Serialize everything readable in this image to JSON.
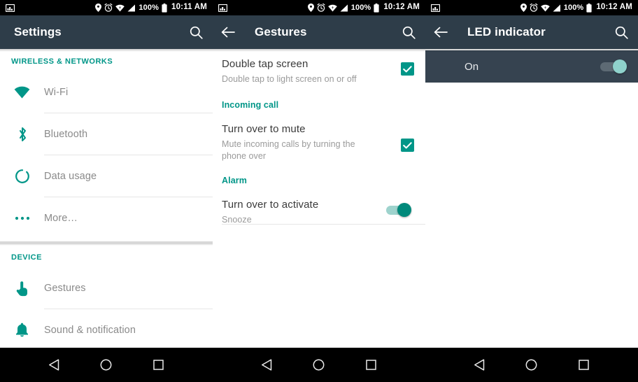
{
  "status_bar": {
    "panels": [
      {
        "left_icon": "image-icon",
        "icons": [
          "location-icon",
          "alarm-icon",
          "wifi-icon",
          "signal-icon"
        ],
        "battery_text": "100%",
        "battery_icon": "battery-full-icon",
        "time": "10:11 AM"
      },
      {
        "left_icon": "image-icon",
        "icons": [
          "location-icon",
          "alarm-icon",
          "wifi-icon",
          "signal-icon"
        ],
        "battery_text": "100%",
        "battery_icon": "battery-full-icon",
        "time": "10:12 AM"
      },
      {
        "left_icon": "image-icon",
        "icons": [
          "location-icon",
          "alarm-icon",
          "wifi-icon",
          "signal-icon"
        ],
        "battery_text": "100%",
        "battery_icon": "battery-full-icon",
        "time": "10:12 AM"
      }
    ]
  },
  "toolbars": [
    {
      "title": "Settings",
      "has_back": false,
      "search_icon": "search-icon"
    },
    {
      "title": "Gestures",
      "has_back": true,
      "back_icon": "back-arrow-icon",
      "search_icon": "search-icon"
    },
    {
      "title": "LED indicator",
      "has_back": true,
      "back_icon": "back-arrow-icon",
      "search_icon": "search-icon"
    }
  ],
  "settings_panel": {
    "sections": [
      {
        "header": "WIRELESS & NETWORKS",
        "items": [
          {
            "label": "Wi-Fi",
            "icon": "wifi-icon"
          },
          {
            "label": "Bluetooth",
            "icon": "bluetooth-icon"
          },
          {
            "label": "Data usage",
            "icon": "data-usage-icon"
          },
          {
            "label": "More…",
            "icon": "more-dots-icon"
          }
        ]
      },
      {
        "header": "DEVICE",
        "items": [
          {
            "label": "Gestures",
            "icon": "hand-pointer-icon"
          },
          {
            "label": "Sound & notification",
            "icon": "bell-icon"
          }
        ]
      }
    ]
  },
  "gestures_panel": {
    "items": [
      {
        "type": "pref",
        "title": "Double tap screen",
        "subtitle": "Double tap to light screen on or off",
        "control": "checkbox",
        "checked": true
      },
      {
        "type": "category",
        "title": "Incoming call"
      },
      {
        "type": "pref",
        "title": "Turn over to mute",
        "subtitle": "Mute incoming calls by turning the phone over",
        "control": "checkbox",
        "checked": true
      },
      {
        "type": "category",
        "title": "Alarm"
      },
      {
        "type": "pref",
        "title": "Turn over to activate",
        "subtitle": "Snooze",
        "control": "switch",
        "checked": true
      }
    ]
  },
  "led_panel": {
    "row": {
      "label": "On",
      "control": "switch",
      "checked": true,
      "highlighted": true
    }
  },
  "nav_bar": {
    "buttons": [
      "back-triangle-icon",
      "home-circle-icon",
      "recents-square-icon"
    ]
  },
  "colors": {
    "toolbar": "#2e3d49",
    "accent": "#009688",
    "status_bar": "#000000",
    "nav_bar": "#000000",
    "highlight_row": "#364350",
    "divider": "#e6e6e6",
    "label_text": "#8a8a8a"
  }
}
